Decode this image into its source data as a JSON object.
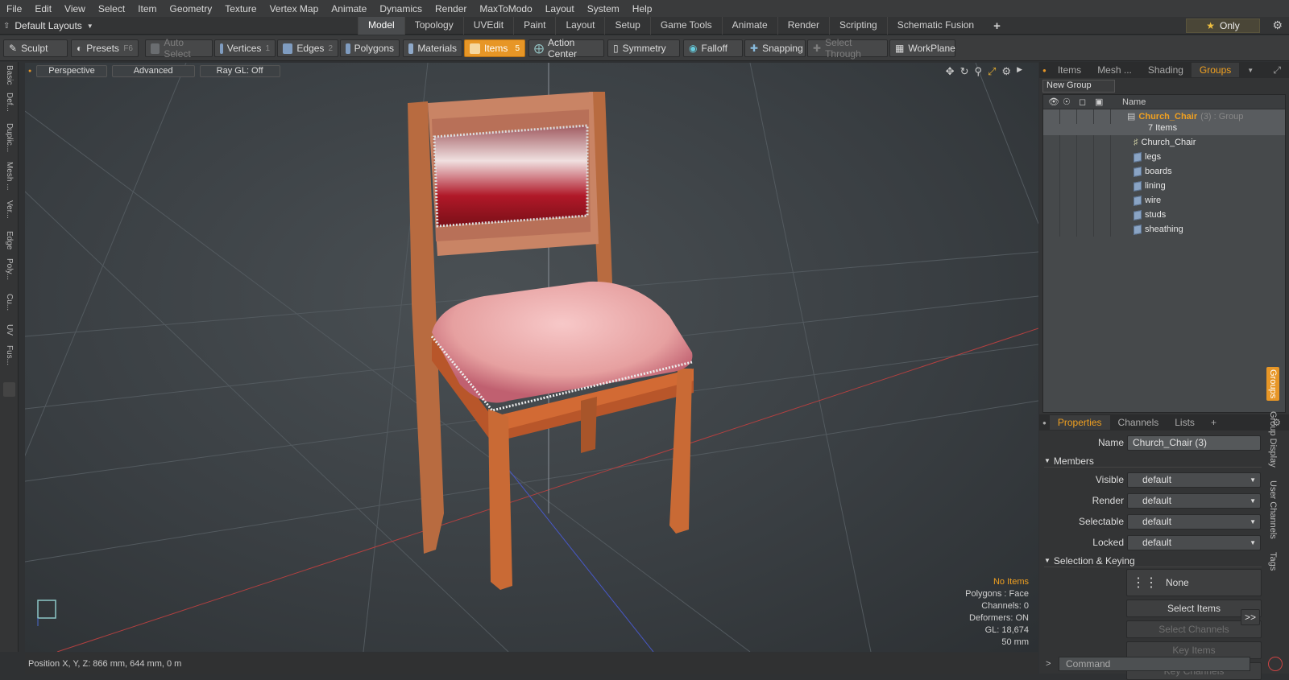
{
  "menu": [
    "File",
    "Edit",
    "View",
    "Select",
    "Item",
    "Geometry",
    "Texture",
    "Vertex Map",
    "Animate",
    "Dynamics",
    "Render",
    "MaxToModo",
    "Layout",
    "System",
    "Help"
  ],
  "layout_selector": "Default Layouts",
  "mode_tabs": [
    "Model",
    "Topology",
    "UVEdit",
    "Paint",
    "Layout",
    "Setup",
    "Game Tools",
    "Animate",
    "Render",
    "Scripting",
    "Schematic Fusion"
  ],
  "active_mode": "Model",
  "only_label": "Only",
  "toolbar": {
    "sculpt": "Sculpt",
    "presets": "Presets",
    "presets_key": "F6",
    "auto_select": "Auto Select",
    "vertices": "Vertices",
    "vertices_key": "1",
    "edges": "Edges",
    "edges_key": "2",
    "polygons": "Polygons",
    "materials": "Materials",
    "items": "Items",
    "items_key": "5",
    "action_center": "Action Center",
    "symmetry": "Symmetry",
    "falloff": "Falloff",
    "snapping": "Snapping",
    "select_through": "Select Through",
    "workplane": "WorkPlane"
  },
  "left_tabs": [
    "Basic",
    "Def...",
    "Duplic...",
    "Mesh ...",
    "Ver...",
    "Edge",
    "Poly...",
    "Cu...",
    "UV",
    "Fus..."
  ],
  "viewport": {
    "view": "Perspective",
    "advanced": "Advanced",
    "raygl": "Ray GL: Off",
    "info": {
      "selection": "No Items",
      "polygons": "Polygons : Face",
      "channels": "Channels: 0",
      "deformers": "Deformers: ON",
      "gl": "GL: 18,674",
      "lens": "50 mm"
    }
  },
  "status": "Position X, Y, Z:  866 mm, 644 mm, 0 m",
  "panel_tabs": [
    "Items",
    "Mesh ...",
    "Shading",
    "Groups"
  ],
  "active_panel_tab": "Groups",
  "new_group": "New Group",
  "tree": {
    "header_name": "Name",
    "group_name": "Church_Chair",
    "group_suffix": "(3) : Group",
    "group_count": "7 Items",
    "members": [
      "Church_Chair",
      "legs",
      "boards",
      "lining",
      "wire",
      "studs",
      "sheathing"
    ]
  },
  "props_tabs": [
    "Properties",
    "Channels",
    "Lists"
  ],
  "properties": {
    "name_label": "Name",
    "name_value": "Church_Chair (3)",
    "members_section": "Members",
    "visible_label": "Visible",
    "visible_value": "default",
    "render_label": "Render",
    "render_value": "default",
    "selectable_label": "Selectable",
    "selectable_value": "default",
    "locked_label": "Locked",
    "locked_value": "default",
    "keying_section": "Selection & Keying",
    "none_label": "None",
    "select_items": "Select Items",
    "select_channels": "Select Channels",
    "key_items": "Key Items",
    "key_channels": "Key Channels",
    "more": ">>"
  },
  "side_tabs": [
    "Groups",
    "Group Display",
    "User Channels",
    "Tags"
  ],
  "command_placeholder": "Command",
  "colors": {
    "accent": "#e79626",
    "selection_text": "#f0a020"
  }
}
